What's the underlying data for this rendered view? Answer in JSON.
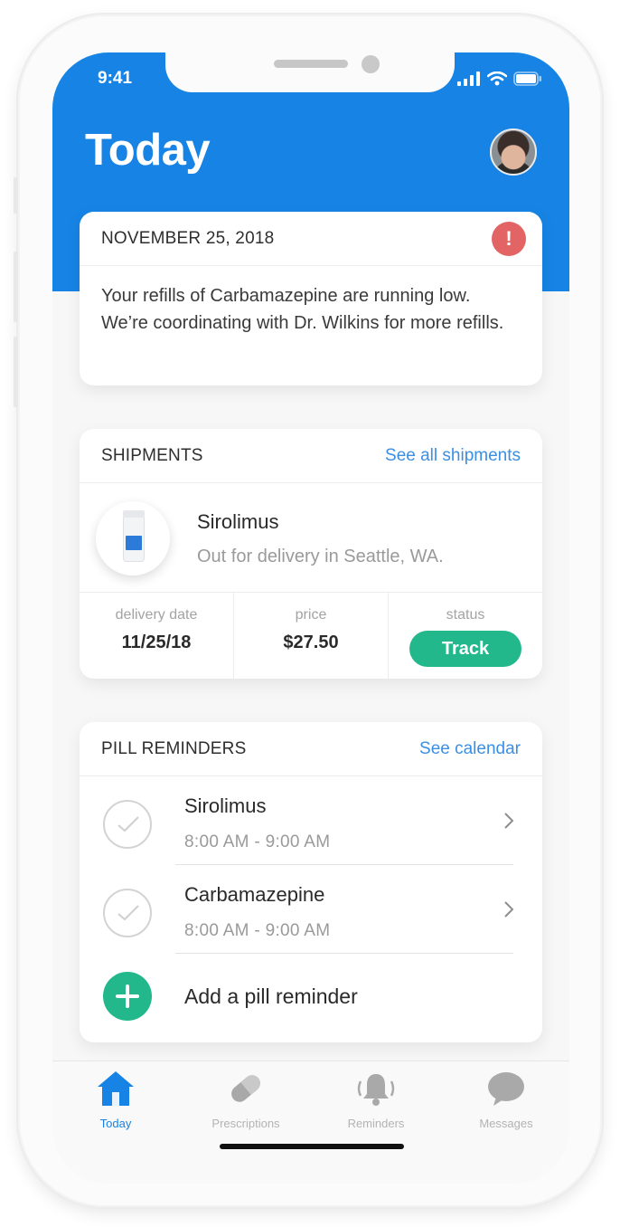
{
  "status_bar": {
    "time": "9:41"
  },
  "header": {
    "title": "Today"
  },
  "alert_card": {
    "date": "NOVEMBER 25, 2018",
    "message": "Your refills of Carbamazepine are running low. We’re coordinating with Dr. Wilkins for more refills."
  },
  "shipments": {
    "title": "SHIPMENTS",
    "link": "See all shipments",
    "item": {
      "name": "Sirolimus",
      "status_text": "Out for delivery in Seattle, WA."
    },
    "stats": {
      "delivery_label": "delivery date",
      "delivery_value": "11/25/18",
      "price_label": "price",
      "price_value": "$27.50",
      "status_label": "status",
      "track_label": "Track"
    }
  },
  "pill_reminders": {
    "title": "PILL REMINDERS",
    "link": "See calendar",
    "items": [
      {
        "name": "Sirolimus",
        "time": "8:00 AM - 9:00 AM"
      },
      {
        "name": "Carbamazepine",
        "time": "8:00 AM - 9:00 AM"
      }
    ],
    "add_label": "Add a pill reminder"
  },
  "tabbar": {
    "tabs": [
      {
        "label": "Today",
        "icon": "home-icon",
        "active": true
      },
      {
        "label": "Prescriptions",
        "icon": "pill-icon",
        "active": false
      },
      {
        "label": "Reminders",
        "icon": "bell-icon",
        "active": false
      },
      {
        "label": "Messages",
        "icon": "chat-bubble-icon",
        "active": false
      }
    ]
  },
  "colors": {
    "primary": "#1784e5",
    "success": "#22b88c",
    "alert": "#e36464",
    "link": "#3b8fe3"
  }
}
